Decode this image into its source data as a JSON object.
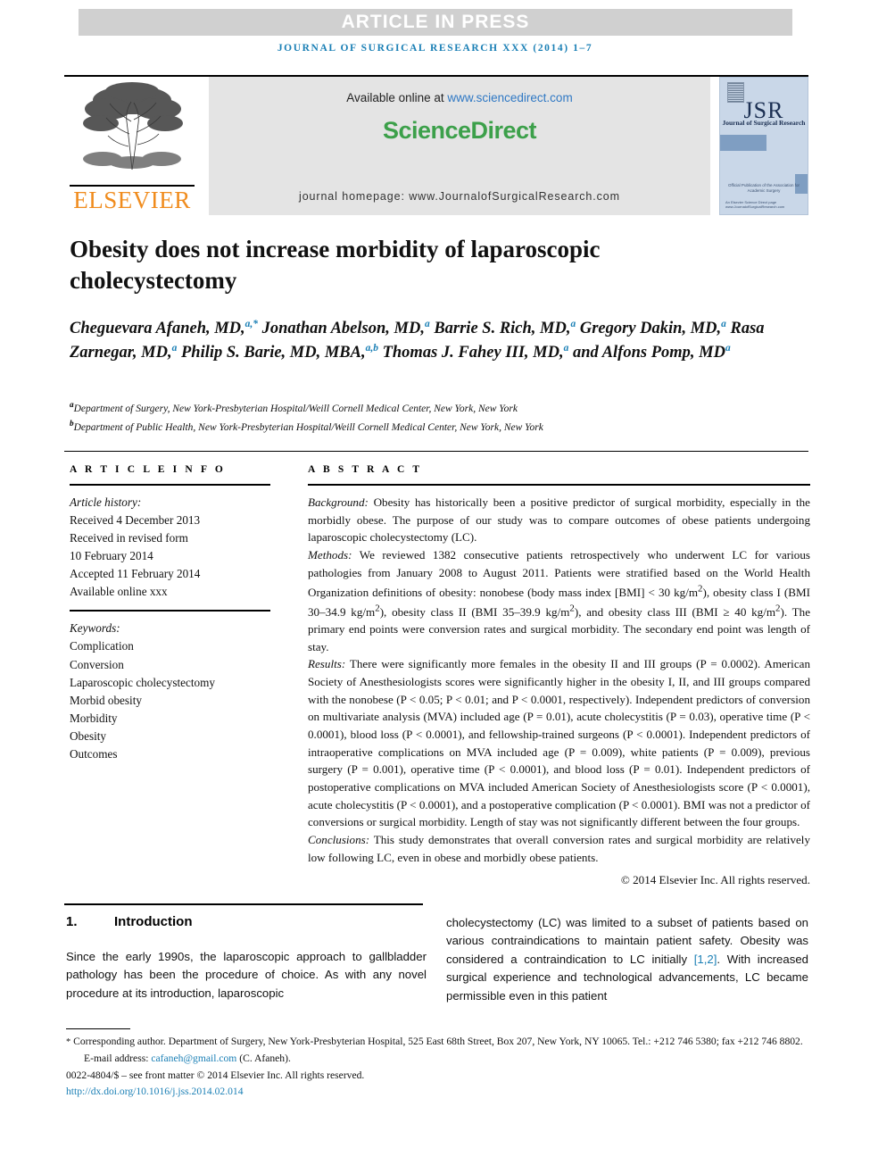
{
  "banner": {
    "press_label": "ARTICLE IN PRESS"
  },
  "running_head": "JOURNAL OF SURGICAL RESEARCH XXX (2014) 1–7",
  "masthead": {
    "elsevier_wordmark": "ELSEVIER",
    "available_prefix": "Available online at ",
    "available_link": "www.sciencedirect.com",
    "sciencedirect_logo": "ScienceDirect",
    "homepage_line": "journal homepage: www.JournalofSurgicalResearch.com",
    "cover": {
      "title": "JSR",
      "subtitle": "Journal of Surgical Research",
      "mid_text": "Official Publication of the Association for Academic Surgery",
      "foot_text": "An Elsevier Science Direct page www.JournalofSurgicalResearch.com"
    }
  },
  "article": {
    "title": "Obesity does not increase morbidity of laparoscopic cholecystectomy",
    "authors_html": "Cheguevara Afaneh, MD,<sup>a,*</sup> Jonathan Abelson, MD,<sup>a</sup> Barrie S. Rich, MD,<sup>a</sup> Gregory Dakin, MD,<sup>a</sup> Rasa Zarnegar, MD,<sup>a</sup> Philip S. Barie, MD, MBA,<sup>a,b</sup> Thomas J. Fahey III, MD,<sup>a</sup> and Alfons Pomp, MD<sup>a</sup>",
    "affiliation_a": "Department of Surgery, New York-Presbyterian Hospital/Weill Cornell Medical Center, New York, New York",
    "affiliation_b": "Department of Public Health, New York-Presbyterian Hospital/Weill Cornell Medical Center, New York, New York"
  },
  "article_info": {
    "heading": "A R T I C L E   I N F O",
    "history_label": "Article history:",
    "history": [
      "Received 4 December 2013",
      "Received in revised form",
      "10 February 2014",
      "Accepted 11 February 2014",
      "Available online xxx"
    ],
    "keywords_label": "Keywords:",
    "keywords": [
      "Complication",
      "Conversion",
      "Laparoscopic cholecystectomy",
      "Morbid obesity",
      "Morbidity",
      "Obesity",
      "Outcomes"
    ]
  },
  "abstract": {
    "heading": "A B S T R A C T",
    "background_label": "Background:",
    "background_text": " Obesity has historically been a positive predictor of surgical morbidity, especially in the morbidly obese. The purpose of our study was to compare outcomes of obese patients undergoing laparoscopic cholecystectomy (LC).",
    "methods_label": "Methods:",
    "methods_text": " We reviewed 1382 consecutive patients retrospectively who underwent LC for various pathologies from January 2008 to August 2011. Patients were stratified based on the World Health Organization definitions of obesity: nonobese (body mass index [BMI] < 30 kg/m2), obesity class I (BMI 30–34.9 kg/m2), obesity class II (BMI 35–39.9 kg/m2), and obesity class III (BMI ≥ 40 kg/m2). The primary end points were conversion rates and surgical morbidity. The secondary end point was length of stay.",
    "results_label": "Results:",
    "results_text": " There were significantly more females in the obesity II and III groups (P = 0.0002). American Society of Anesthesiologists scores were significantly higher in the obesity I, II, and III groups compared with the nonobese (P < 0.05; P < 0.01; and P < 0.0001, respectively). Independent predictors of conversion on multivariate analysis (MVA) included age (P = 0.01), acute cholecystitis (P = 0.03), operative time (P < 0.0001), blood loss (P < 0.0001), and fellowship-trained surgeons (P < 0.0001). Independent predictors of intraoperative complications on MVA included age (P = 0.009), white patients (P = 0.009), previous surgery (P = 0.001), operative time (P < 0.0001), and blood loss (P = 0.01). Independent predictors of postoperative complications on MVA included American Society of Anesthesiologists score (P < 0.0001), acute cholecystitis (P < 0.0001), and a postoperative complication (P < 0.0001). BMI was not a predictor of conversions or surgical morbidity. Length of stay was not significantly different between the four groups.",
    "conclusions_label": "Conclusions:",
    "conclusions_text": " This study demonstrates that overall conversion rates and surgical morbidity are relatively low following LC, even in obese and morbidly obese patients.",
    "copyright": "© 2014 Elsevier Inc. All rights reserved."
  },
  "introduction": {
    "number": "1.",
    "heading": "Introduction",
    "left_text": "Since the early 1990s, the laparoscopic approach to gallbladder pathology has been the procedure of choice. As with any novel procedure at its introduction, laparoscopic",
    "right_text_part1": "cholecystectomy (LC) was limited to a subset of patients based on various contraindications to maintain patient safety. Obesity was considered a contraindication to LC initially ",
    "right_citation": "[1,2]",
    "right_text_part2": ". With increased surgical experience and technological advancements, LC became permissible even in this patient"
  },
  "footnotes": {
    "corresponding_star": "*",
    "corresponding_text": " Corresponding author. Department of Surgery, New York-Presbyterian Hospital, 525 East 68th Street, Box 207, New York, NY 10065. Tel.: +212 746 5380; fax +212 746 8802.",
    "email_label": "E-mail address: ",
    "email": "cafaneh@gmail.com",
    "email_suffix": " (C. Afaneh).",
    "issn_line": "0022-4804/$ – see front matter © 2014 Elsevier Inc. All rights reserved.",
    "doi": "http://dx.doi.org/10.1016/j.jss.2014.02.014"
  },
  "colors": {
    "accent_blue": "#1a7fb5",
    "link_blue": "#2f78c4",
    "sciencedirect_green": "#3CA04A",
    "elsevier_orange": "#F08C1E",
    "banner_gray": "#d0d0d0"
  }
}
